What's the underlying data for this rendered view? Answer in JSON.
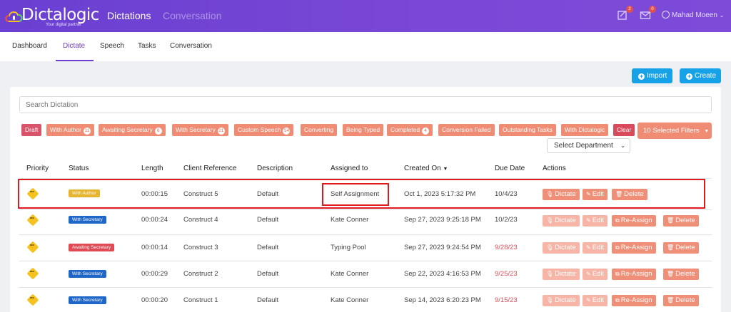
{
  "app": {
    "logo_text": "Dictalogic",
    "tagline": "Your digital partner",
    "nav": [
      "Dictations",
      "Conversation"
    ],
    "notif_count": "2",
    "mail_count": "0",
    "user_name": "Mahad Moeen"
  },
  "subnav": [
    "Dashboard",
    "Dictate",
    "Speech",
    "Tasks",
    "Conversation"
  ],
  "toolbar": {
    "import_label": "Import",
    "create_label": "Create"
  },
  "search": {
    "placeholder": "Search Dictation"
  },
  "filters": [
    {
      "label": "Draft",
      "count": ""
    },
    {
      "label": "With Author",
      "count": "11"
    },
    {
      "label": "Awaiting Secretary",
      "count": "6"
    },
    {
      "label": "With Secretary",
      "count": "21"
    },
    {
      "label": "Custom Speech",
      "count": "54"
    },
    {
      "label": "Converting",
      "count": ""
    },
    {
      "label": "Being Typed",
      "count": ""
    },
    {
      "label": "Completed",
      "count": "4"
    },
    {
      "label": "Conversion Failed",
      "count": ""
    },
    {
      "label": "Outstanding Tasks",
      "count": ""
    },
    {
      "label": "With Dictalogic",
      "count": ""
    },
    {
      "label": "Clear",
      "count": ""
    }
  ],
  "selected_filters_label": "10 Selected Filters",
  "department_select": "Select Department",
  "table": {
    "columns": [
      "Priority",
      "Status",
      "Length",
      "Client Reference",
      "Description",
      "Assigned to",
      "Created On",
      "Due Date",
      "Actions"
    ],
    "rows": [
      {
        "status": "With Author",
        "length": "00:00:15",
        "client": "Construct 5",
        "desc": "Default",
        "assigned": "Self Assignment",
        "created": "Oct 1, 2023 5:17:32 PM",
        "due": "10/4/23"
      },
      {
        "status": "With Secretary",
        "length": "00:00:24",
        "client": "Construct 4",
        "desc": "Default",
        "assigned": "Kate Conner",
        "created": "Sep 27, 2023 9:25:18 PM",
        "due": "10/2/23"
      },
      {
        "status": "Awaiting Secretary",
        "length": "00:00:14",
        "client": "Construct 3",
        "desc": "Default",
        "assigned": "Typing Pool",
        "created": "Sep 27, 2023 9:24:54 PM",
        "due": "9/28/23"
      },
      {
        "status": "With Secretary",
        "length": "00:00:29",
        "client": "Construct 2",
        "desc": "Default",
        "assigned": "Kate Conner",
        "created": "Sep 22, 2023 4:16:53 PM",
        "due": "9/25/23"
      },
      {
        "status": "With Secretary",
        "length": "00:00:20",
        "client": "Construct 1",
        "desc": "Default",
        "assigned": "Kate Conner",
        "created": "Sep 14, 2023 6:20:23 PM",
        "due": "9/15/23"
      }
    ],
    "actions": {
      "dictate": "Dictate",
      "edit": "Edit",
      "reassign": "Re-Assign",
      "delete": "Delete"
    }
  },
  "colors": {
    "brand": "#6a3fd1",
    "accent": "#17a2e8",
    "chip": "#f08c74",
    "alert": "#e0191e"
  }
}
